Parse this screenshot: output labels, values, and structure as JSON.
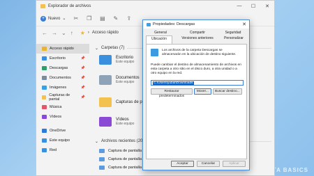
{
  "explorer": {
    "title": "Explorador de archivos",
    "toolbar": {
      "new_label": "Nuevo",
      "new_caret": "⌄"
    },
    "address": {
      "path": "Acceso rápido",
      "caret": "›"
    },
    "sidebar": [
      {
        "label": "Acceso rápido",
        "icon": "star-icon",
        "color": "#e9b42e",
        "selected": true
      },
      {
        "label": "Escritorio",
        "icon": "desktop-icon",
        "color": "#3a8fde",
        "pin": "📌"
      },
      {
        "label": "Descargas",
        "icon": "download-icon",
        "color": "#2f9e6a",
        "pin": "📌"
      },
      {
        "label": "Documentos",
        "icon": "documents-icon",
        "color": "#7a8aa0",
        "pin": "📌"
      },
      {
        "label": "Imágenes",
        "icon": "pictures-icon",
        "color": "#3aa0e6",
        "pin": "📌"
      },
      {
        "label": "Capturas de pantal",
        "icon": "folder-icon",
        "color": "#f2c14e",
        "pin": "📌"
      },
      {
        "label": "Música",
        "icon": "music-icon",
        "color": "#e0566a"
      },
      {
        "label": "Vídeos",
        "icon": "videos-icon",
        "color": "#8a4ad6"
      },
      {
        "label": "OneDrive",
        "icon": "cloud-icon",
        "color": "#2f7ad8"
      },
      {
        "label": "Este equipo",
        "icon": "computer-icon",
        "color": "#3a8fde"
      },
      {
        "label": "Red",
        "icon": "network-icon",
        "color": "#3a8fde"
      }
    ],
    "content": {
      "folders_header": "Carpetas (7)",
      "folders": [
        {
          "name": "Escritorio",
          "sub": "Este equipo",
          "color": "#3a8fde"
        },
        {
          "name": "Documentos",
          "sub": "Este equipo",
          "color": "#8ea3b8"
        },
        {
          "name": "Capturas de pantalla",
          "sub": "",
          "color": "#f2c14e"
        },
        {
          "name": "Vídeos",
          "sub": "Este equipo",
          "color": "#8a4ad6"
        }
      ],
      "recent_header": "Archivos recientes (20)",
      "recent": [
        "Captura de pantalla (",
        "Captura de pantalla (",
        "Captura de pantalla ("
      ]
    }
  },
  "dialog": {
    "title": "Propiedades: Descargas",
    "close": "✕",
    "tabs": {
      "general": "General",
      "share": "Compartir",
      "security": "Seguridad",
      "location": "Ubicación",
      "versions": "Versiones anteriores",
      "custom": "Personalizar"
    },
    "info": "Los archivos de la carpeta Descargas se almacenarán en la ubicación de destino siguiente.",
    "description": "Puede cambiar el destino de almacenamiento de archivos en esta carpeta a otro sitio en el disco duro, a otra unidad o a otro equipo en la red.",
    "path": "C:\\Users\\yubal\\Downloads",
    "buttons": {
      "restore": "Restaurar predeterminados",
      "move": "Mover...",
      "find": "Buscar destino..."
    },
    "footer": {
      "accept": "Aceptar",
      "cancel": "Cancelar",
      "apply": "Aplicar"
    }
  },
  "watermark": "GENBETA BASICS",
  "colors": {
    "accent": "#3a7bd5",
    "selection": "#0a64c8"
  }
}
